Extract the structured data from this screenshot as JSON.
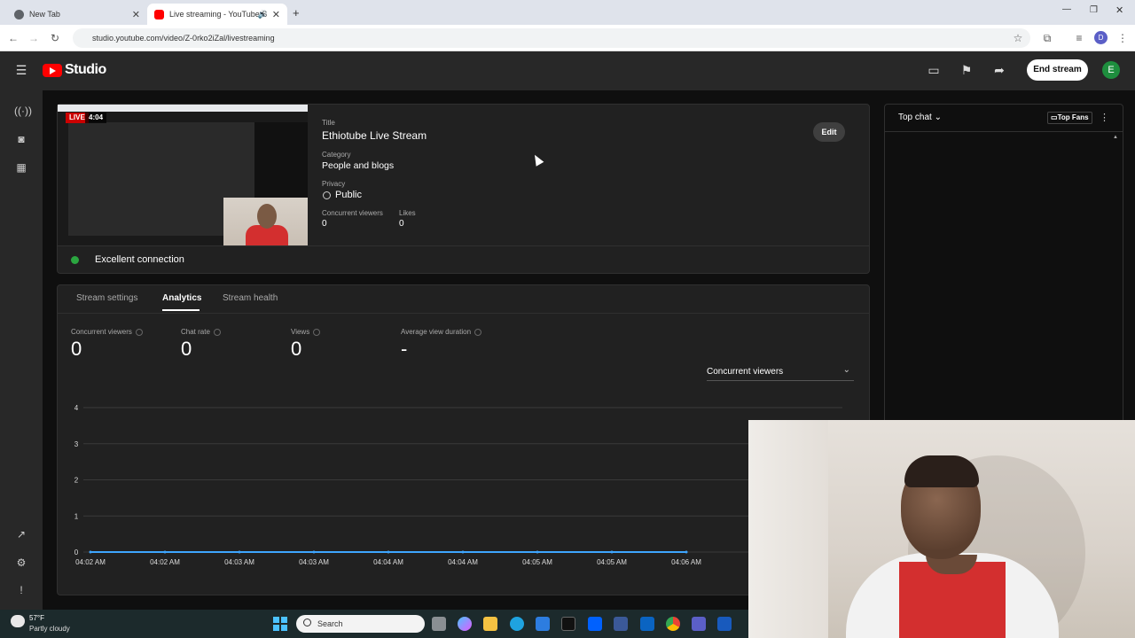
{
  "browser": {
    "tabs": [
      {
        "title": "New Tab",
        "active": false
      },
      {
        "title": "Live streaming - YouTube S",
        "active": true
      }
    ],
    "url": "studio.youtube.com/video/Z-0rko2iZal/livestreaming",
    "profile_initial": "D"
  },
  "header": {
    "logo_text": "Studio",
    "end_stream_label": "End stream",
    "avatar_initial": "E"
  },
  "stream": {
    "live_label": "LIVE",
    "elapsed": "4:04",
    "title_label": "Title",
    "title": "Ethiotube Live Stream",
    "category_label": "Category",
    "category": "People and blogs",
    "privacy_label": "Privacy",
    "privacy": "Public",
    "viewers_label": "Concurrent viewers",
    "viewers": "0",
    "likes_label": "Likes",
    "likes": "0",
    "edit_label": "Edit",
    "connection": "Excellent connection"
  },
  "panel_tabs": [
    "Stream settings",
    "Analytics",
    "Stream health"
  ],
  "metrics": [
    {
      "label": "Concurrent viewers",
      "value": "0"
    },
    {
      "label": "Chat rate",
      "value": "0"
    },
    {
      "label": "Views",
      "value": "0"
    },
    {
      "label": "Average view duration",
      "value": "-"
    }
  ],
  "metric_select": "Concurrent viewers",
  "chart_data": {
    "type": "line",
    "x": [
      "04:02 AM",
      "04:02 AM",
      "04:03 AM",
      "04:03 AM",
      "04:04 AM",
      "04:04 AM",
      "04:05 AM",
      "04:05 AM",
      "04:06 AM"
    ],
    "series": [
      {
        "values": [
          0,
          0,
          0,
          0,
          0,
          0,
          0,
          0,
          0
        ]
      }
    ],
    "yticks": [
      "4",
      "3",
      "2",
      "1",
      "0"
    ],
    "ylim": [
      0,
      4
    ],
    "grid": true,
    "line_color": "#3ea6ff"
  },
  "chat": {
    "mode_label": "Top chat",
    "top_fans_label": "Top Fans"
  },
  "taskbar": {
    "temperature": "57°F",
    "weather": "Partly cloudy",
    "search_placeholder": "Search"
  },
  "colors": {
    "accent_red": "#ff0000",
    "live_red": "#cc0000",
    "connection_green": "#2ba640",
    "avatar_green": "#1e8e3e"
  }
}
